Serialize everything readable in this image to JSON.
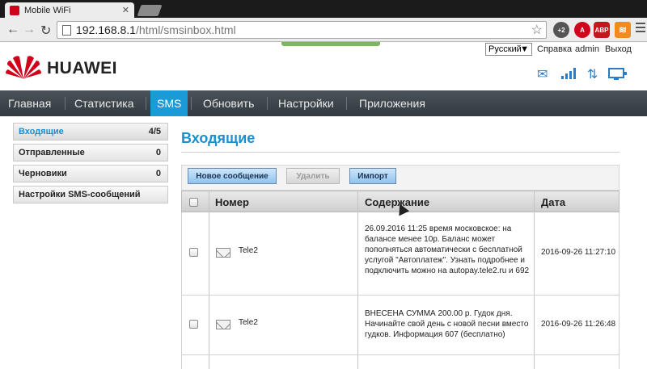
{
  "browser": {
    "tab_title": "Mobile WiFi",
    "url_host": "192.168.8.1",
    "url_path": "/html/smsinbox.html",
    "ext_badge": "+2",
    "abp_label": "ABP"
  },
  "header": {
    "brand": "HUAWEI",
    "language": "Русский",
    "help": "Справка",
    "user": "admin",
    "logout": "Выход"
  },
  "menu": [
    "Главная",
    "Статистика",
    "SMS",
    "Обновить",
    "Настройки",
    "Приложения"
  ],
  "sidebar": [
    {
      "label": "Входящие",
      "count": "4/5"
    },
    {
      "label": "Отправленные",
      "count": "0"
    },
    {
      "label": "Черновики",
      "count": "0"
    },
    {
      "label": "Настройки SMS-сообщений",
      "count": ""
    }
  ],
  "main": {
    "title": "Входящие",
    "buttons": {
      "new": "Новое сообщение",
      "delete": "Удалить",
      "import": "Импорт"
    },
    "columns": {
      "number": "Номер",
      "content": "Содержание",
      "date": "Дата"
    },
    "rows": [
      {
        "sender": "Tele2",
        "content": "26.09.2016 11:25 время московское: на балансе менее 10р. Баланс может пополняться автоматически с бесплатной услугой \"Автоплатеж\". Узнать подробнее и подключить можно на autopay.tele2.ru и 692",
        "date": "2016-09-26 11:27:10"
      },
      {
        "sender": "Tele2",
        "content": "ВНЕСЕНА СУММА 200.00 р. Гудок дня. Начинайте свой день с новой песни вместо гудков. Информация 607 (бесплатно)",
        "date": "2016-09-26 11:26:48"
      }
    ]
  },
  "colors": {
    "accent": "#1a9bd7",
    "menubar": "#3a4248",
    "brand_red": "#d0021b"
  }
}
